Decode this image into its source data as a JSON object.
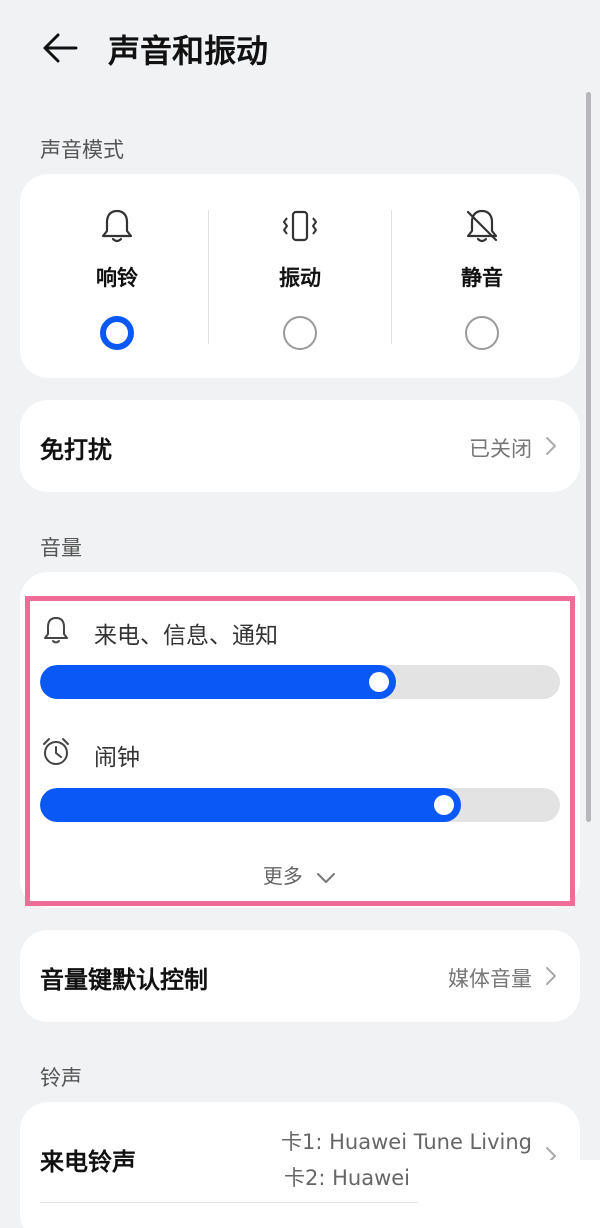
{
  "header": {
    "title": "声音和振动"
  },
  "sound_mode": {
    "section_label": "声音模式",
    "options": [
      {
        "label": "响铃",
        "icon": "bell-icon",
        "selected": true
      },
      {
        "label": "振动",
        "icon": "vibrate-icon",
        "selected": false
      },
      {
        "label": "静音",
        "icon": "bell-off-icon",
        "selected": false
      }
    ]
  },
  "dnd": {
    "label": "免打扰",
    "value": "已关闭"
  },
  "volume": {
    "section_label": "音量",
    "items": [
      {
        "label": "来电、信息、通知",
        "icon": "bell-icon",
        "level": 0.685
      },
      {
        "label": "闹钟",
        "icon": "alarm-clock-icon",
        "level": 0.81
      }
    ],
    "more_label": "更多"
  },
  "volume_key": {
    "label": "音量键默认控制",
    "value": "媒体音量"
  },
  "ringtone": {
    "section_label": "铃声",
    "call_label": "来电铃声",
    "line1": "卡1: Huawei Tune Living",
    "line2": "卡2: Huawei"
  },
  "colors": {
    "accent": "#0a59f7",
    "highlight": "#ee6d96",
    "background": "#f1f2f4"
  }
}
